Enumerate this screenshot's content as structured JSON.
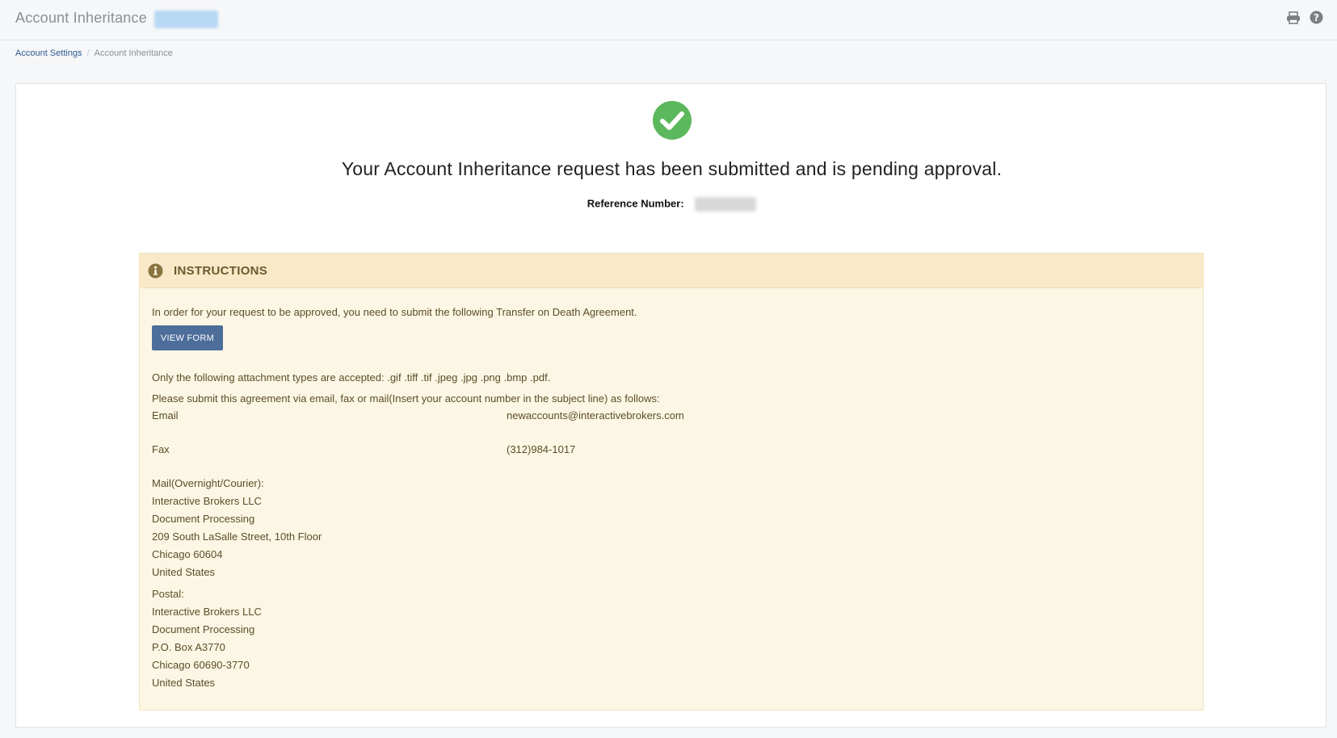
{
  "header": {
    "title": "Account Inheritance",
    "print_icon": "printer-icon",
    "help_icon": "help-icon"
  },
  "breadcrumb": {
    "parent": "Account Settings",
    "separator": "/",
    "current": "Account Inheritance"
  },
  "confirmation": {
    "icon": "check-circle-icon",
    "icon_color": "#5cb85c",
    "message": "Your Account Inheritance request has been submitted and is pending approval.",
    "reference_label": "Reference Number:"
  },
  "instructions": {
    "icon": "info-circle-icon",
    "title": "INSTRUCTIONS",
    "intro": "In order for your request to be approved, you need to submit the following Transfer on Death Agreement.",
    "view_form_label": "VIEW FORM",
    "attachment_note": "Only the following attachment types are accepted: .gif .tiff .tif .jpeg .jpg .png .bmp .pdf.",
    "submit_note": "Please submit this agreement via email, fax or mail(Insert your account number in the subject line) as follows:",
    "email_label": "Email",
    "email_value": "newaccounts@interactivebrokers.com",
    "fax_label": "Fax",
    "fax_value": "(312)984-1017",
    "mail_heading": "Mail(Overnight/Courier):",
    "mail_address": [
      "Interactive Brokers LLC",
      "Document Processing",
      "209 South LaSalle Street, 10th Floor",
      "Chicago 60604",
      "United States"
    ],
    "postal_heading": "Postal:",
    "postal_address": [
      "Interactive Brokers LLC",
      "Document Processing",
      "P.O. Box A3770",
      "Chicago 60690-3770",
      "United States"
    ]
  },
  "colors": {
    "link": "#2f5b93",
    "button": "#4d6d9a",
    "panel_bg": "#fcf7e4",
    "panel_header_bg": "#f9e9c9",
    "success": "#5cb85c"
  }
}
